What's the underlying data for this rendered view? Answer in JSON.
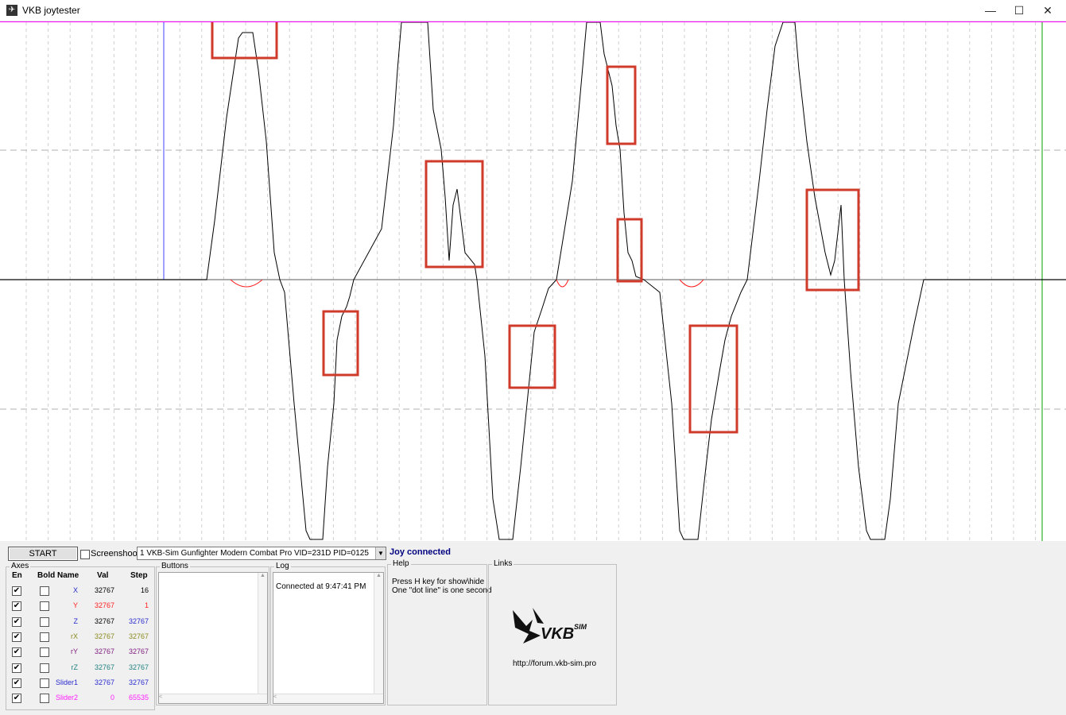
{
  "window": {
    "title": "VKB joytester",
    "icon": "vkb-bird-icon",
    "controls": {
      "minimize": "—",
      "maximize": "☐",
      "close": "✕"
    }
  },
  "toolbar": {
    "start_label": "START",
    "screenshoot_label": "Screenshoot",
    "screenshoot_checked": false,
    "device_value": "1  VKB-Sim Gunfighter Modern Combat Pro  VID=231D PID=0125",
    "status": "Joy connected"
  },
  "axes": {
    "title": "Axes",
    "headers": {
      "en": "En",
      "bold": "Bold",
      "name": "Name",
      "val": "Val",
      "step": "Step"
    },
    "rows": [
      {
        "en": true,
        "bold": false,
        "name": "X",
        "val": "32767",
        "step": "16",
        "color": "#2a2ad0",
        "step_color": "#000000",
        "val_color": "#000000"
      },
      {
        "en": true,
        "bold": false,
        "name": "Y",
        "val": "32767",
        "step": "1",
        "color": "#ff2020",
        "step_color": "#ff2020",
        "val_color": "#ff2020"
      },
      {
        "en": true,
        "bold": false,
        "name": "Z",
        "val": "32767",
        "step": "32767",
        "color": "#2a2ad0",
        "step_color": "#2a2ad0",
        "val_color": "#000000"
      },
      {
        "en": true,
        "bold": false,
        "name": "rX",
        "val": "32767",
        "step": "32767",
        "color": "#8a8a20",
        "step_color": "#8a8a20",
        "val_color": "#8a8a20"
      },
      {
        "en": true,
        "bold": false,
        "name": "rY",
        "val": "32767",
        "step": "32767",
        "color": "#802080",
        "step_color": "#802080",
        "val_color": "#802080"
      },
      {
        "en": true,
        "bold": false,
        "name": "rZ",
        "val": "32767",
        "step": "32767",
        "color": "#208080",
        "step_color": "#208080",
        "val_color": "#208080"
      },
      {
        "en": true,
        "bold": false,
        "name": "Slider1",
        "val": "32767",
        "step": "32767",
        "color": "#2a2ad0",
        "step_color": "#2a2ad0",
        "val_color": "#2a2ad0"
      },
      {
        "en": true,
        "bold": false,
        "name": "Slider2",
        "val": "0",
        "step": "65535",
        "color": "#ff20ff",
        "step_color": "#ff20ff",
        "val_color": "#ff20ff"
      }
    ]
  },
  "buttons_group": {
    "title": "Buttons"
  },
  "log_group": {
    "title": "Log",
    "lines": [
      "Connected at 9:47:41 PM"
    ]
  },
  "help_group": {
    "title": "Help",
    "line1": "Press H key for show\\hide",
    "line2": "One \"dot line\" is one second"
  },
  "links_group": {
    "title": "Links",
    "logo_text": "VKB",
    "logo_sup": "SIM",
    "url": "http://forum.vkb-sim.pro"
  },
  "colors": {
    "trace": "#000000",
    "trace_y": "#ff2020",
    "top_line": "#ff00ff",
    "cursor": "#4040ff",
    "right_edge": "#00a000",
    "highlight_box": "#d03a2a"
  }
}
